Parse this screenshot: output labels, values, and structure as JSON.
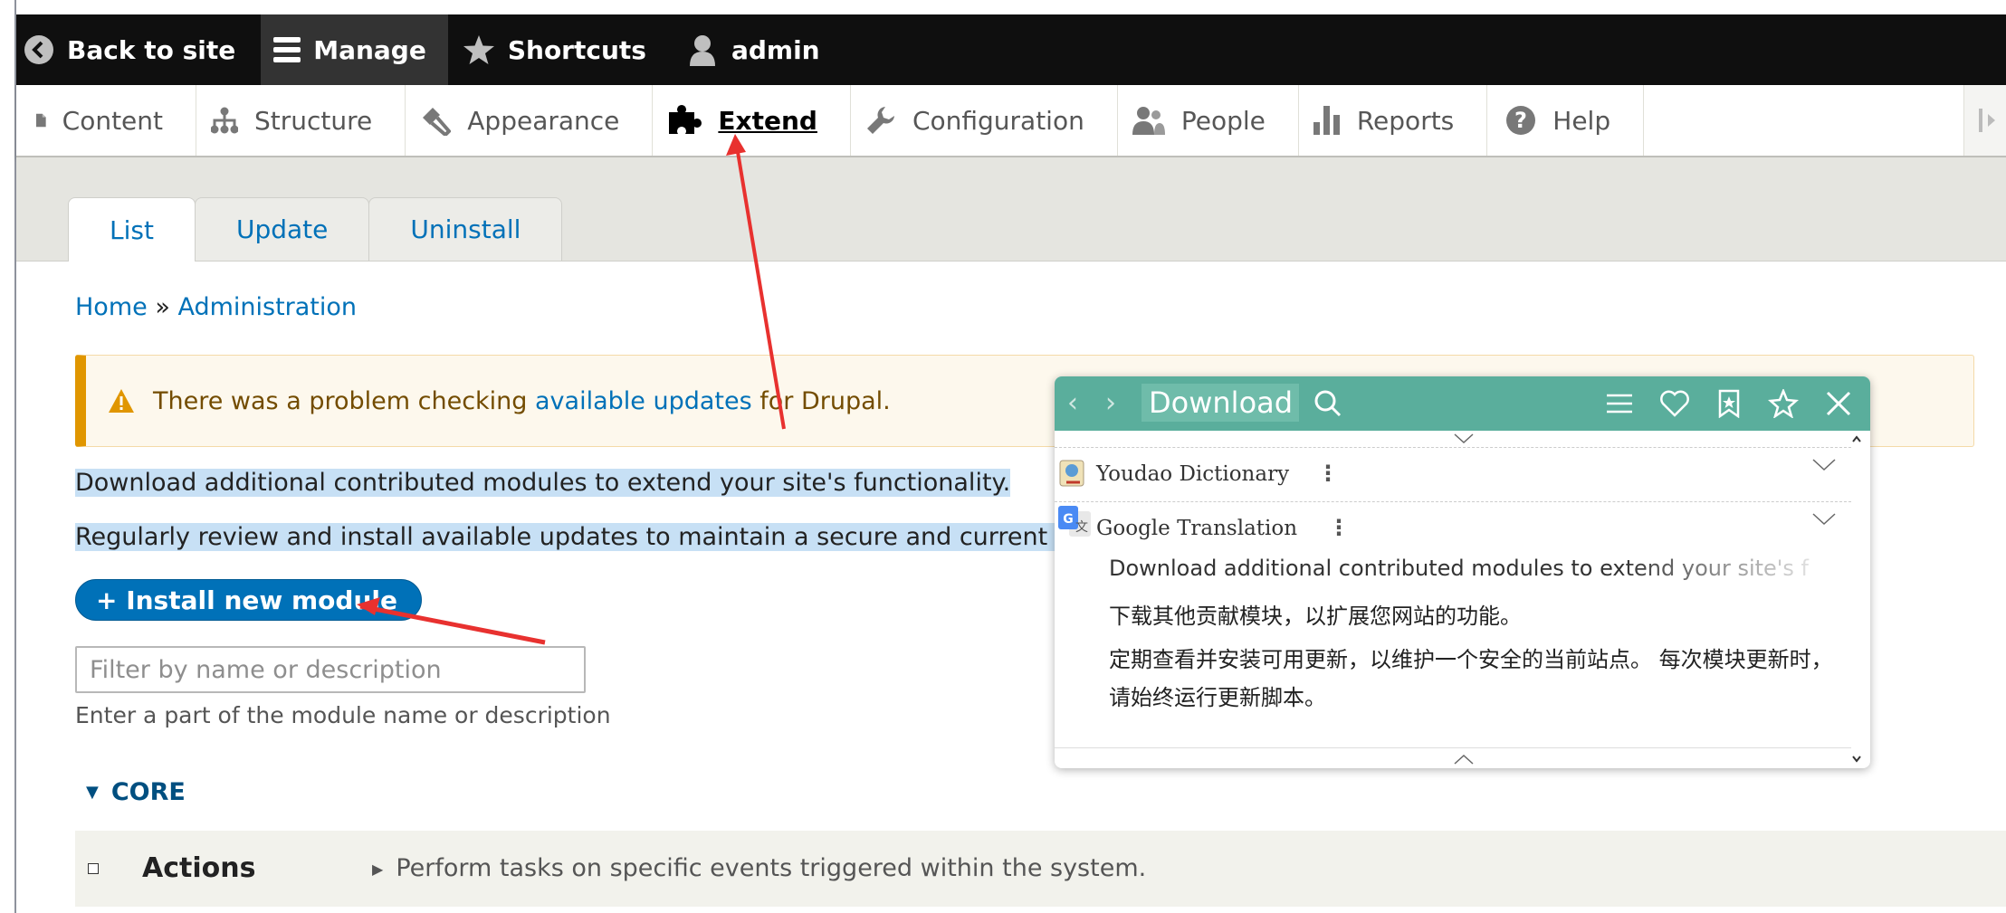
{
  "toolbar": {
    "back": "Back to site",
    "manage": "Manage",
    "shortcuts": "Shortcuts",
    "user": "admin"
  },
  "tray": {
    "items": [
      "Content",
      "Structure",
      "Appearance",
      "Extend",
      "Configuration",
      "People",
      "Reports",
      "Help"
    ]
  },
  "tabs": [
    "List",
    "Update",
    "Uninstall"
  ],
  "breadcrumb": {
    "home": "Home",
    "sep": "»",
    "admin": "Administration"
  },
  "warning": {
    "pre": "There was a problem checking ",
    "link": "available updates",
    "post": " for Drupal."
  },
  "intro": {
    "line1": "Download additional contributed modules to extend your site's functionality.",
    "line2": "Regularly review and install available updates to maintain a secure and current site"
  },
  "install_button": "+ Install new module",
  "filter": {
    "placeholder": "Filter by name or description",
    "description": "Enter a part of the module name or description"
  },
  "core": {
    "label": "CORE"
  },
  "modules": [
    {
      "name": "Actions",
      "description": "Perform tasks on specific events triggered within the system."
    }
  ],
  "popup": {
    "search_value": "Download a",
    "dictionaries": [
      "Youdao Dictionary",
      "Google Translation"
    ],
    "source_text": "Download additional contributed modules to extend your site's f",
    "translation_1": "下载其他贡献模块，以扩展您网站的功能。",
    "translation_2": "定期查看并安装可用更新，以维护一个安全的当前站点。 每次模块更新时，请始终运行更新脚本。"
  },
  "colors": {
    "toolbar_bg": "#0f0f0f",
    "link": "#0071b8",
    "popup_header": "#5aae9c",
    "warning_border": "#e09600",
    "annotation_arrow": "#e8312f"
  }
}
